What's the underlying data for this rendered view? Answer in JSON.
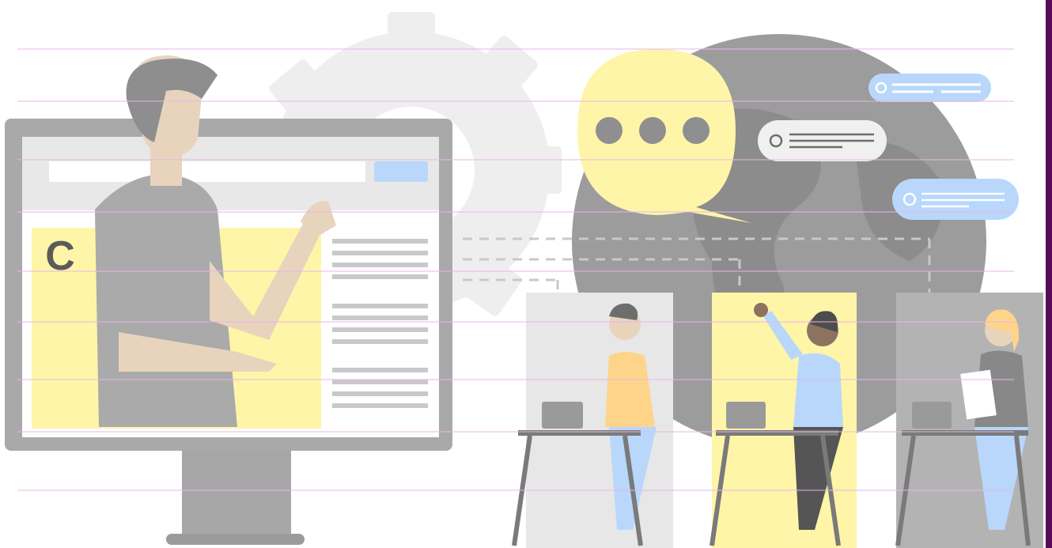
{
  "illustration": {
    "monitor_logo_letter": "C",
    "colors": {
      "accent_yellow": "#fff5a8",
      "accent_blue": "#b8d7fb",
      "gray_light": "#e7e7e7",
      "gray_mid": "#b8b8b8",
      "gray_dark": "#9a9a9a",
      "border_purple": "#5a0a59",
      "rule_pink": "#e8b4ea"
    },
    "chat_bubbles": [
      {
        "name": "chat-bubble-blue-top",
        "color": "#b8d7fb"
      },
      {
        "name": "chat-bubble-gray",
        "color": "#f0f0f0"
      },
      {
        "name": "chat-bubble-blue-bottom",
        "color": "#b8d7fb"
      }
    ],
    "students": [
      {
        "name": "student-orange-shirt",
        "panel_color": "#e7e7e7"
      },
      {
        "name": "student-raised-hand",
        "panel_color": "#fff5a8"
      },
      {
        "name": "student-holding-paper",
        "panel_color": "#b3b3b3"
      }
    ]
  }
}
